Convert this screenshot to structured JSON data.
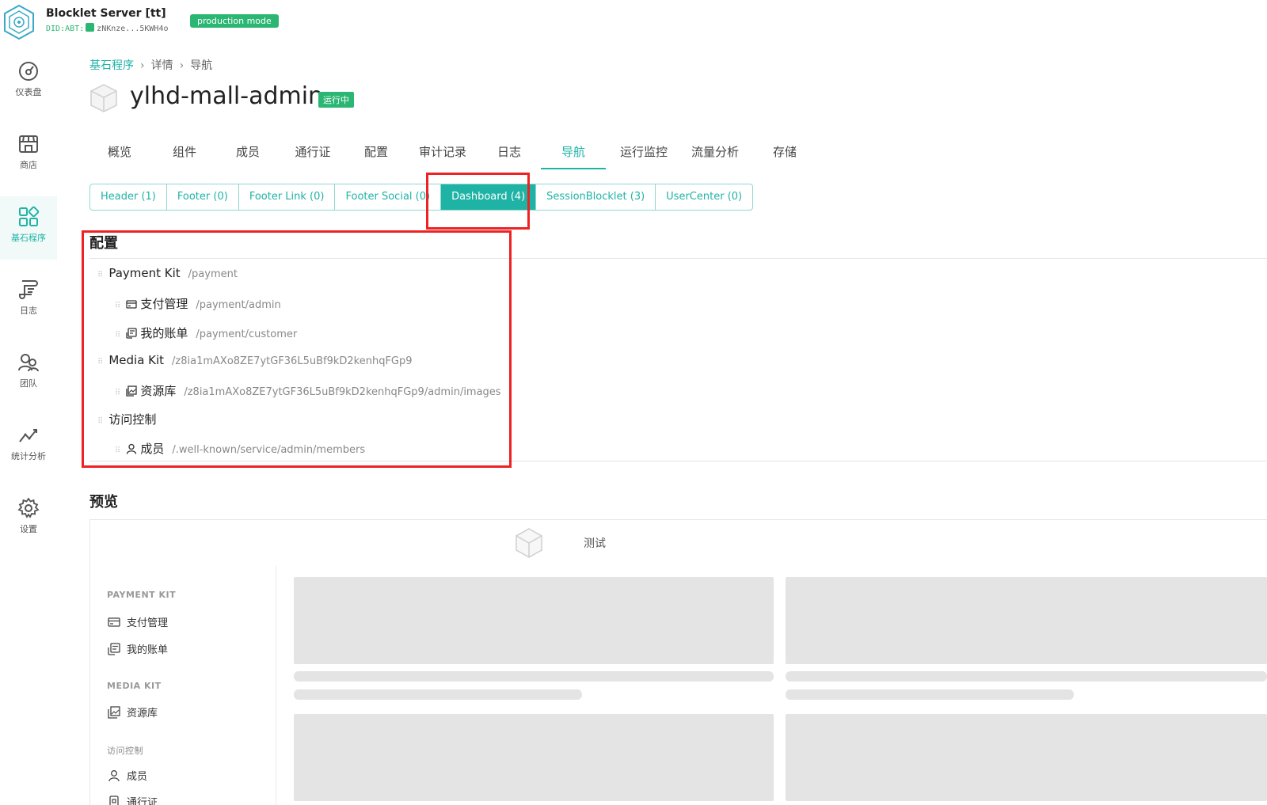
{
  "header": {
    "server_name": "Blocklet Server [tt]",
    "did_prefix": "DID:ABT:",
    "did_value": "zNKnze...5KWH4o",
    "mode_badge": "production mode"
  },
  "sidebar": {
    "items": [
      {
        "label": "仪表盘",
        "icon": "dashboard-icon",
        "active": false
      },
      {
        "label": "商店",
        "icon": "store-icon",
        "active": false
      },
      {
        "label": "基石程序",
        "icon": "blocklets-icon",
        "active": true
      },
      {
        "label": "日志",
        "icon": "log-icon",
        "active": false
      },
      {
        "label": "团队",
        "icon": "team-icon",
        "active": false
      },
      {
        "label": "统计分析",
        "icon": "analytics-icon",
        "active": false
      },
      {
        "label": "设置",
        "icon": "settings-icon",
        "active": false
      }
    ]
  },
  "breadcrumb": {
    "root": "基石程序",
    "middle": "详情",
    "current": "导航"
  },
  "app": {
    "title": "ylhd-mall-admin",
    "status": "运行中"
  },
  "main_tabs": [
    "概览",
    "组件",
    "成员",
    "通行证",
    "配置",
    "审计记录",
    "日志",
    "导航",
    "运行监控",
    "流量分析",
    "存储"
  ],
  "active_main_tab": "导航",
  "sub_tabs": [
    "Header (1)",
    "Footer (0)",
    "Footer Link (0)",
    "Footer Social (0)",
    "Dashboard (4)",
    "SessionBlocklet (3)",
    "UserCenter (0)"
  ],
  "active_sub_tab": "Dashboard (4)",
  "config": {
    "title": "配置",
    "rows": [
      {
        "title": "Payment Kit",
        "path": "/payment",
        "level": 0,
        "icon": ""
      },
      {
        "title": "支付管理",
        "path": "/payment/admin",
        "level": 1,
        "icon": "credit-card-icon"
      },
      {
        "title": "我的账单",
        "path": "/payment/customer",
        "level": 1,
        "icon": "receipt-icon"
      },
      {
        "title": "Media Kit",
        "path": "/z8ia1mAXo8ZE7ytGF36L5uBf9kD2kenhqFGp9",
        "level": 0,
        "icon": ""
      },
      {
        "title": "资源库",
        "path": "/z8ia1mAXo8ZE7ytGF36L5uBf9kD2kenhqFGp9/admin/images",
        "level": 1,
        "icon": "image-library-icon"
      },
      {
        "title": "访问控制",
        "path": "",
        "level": 0,
        "icon": ""
      },
      {
        "title": "成员",
        "path": "/.well-known/service/admin/members",
        "level": 1,
        "icon": "user-icon"
      }
    ]
  },
  "preview": {
    "title": "预览",
    "app_name": "测试",
    "groups": [
      {
        "name": "PAYMENT KIT",
        "items": [
          {
            "label": "支付管理",
            "icon": "credit-card-icon"
          },
          {
            "label": "我的账单",
            "icon": "receipt-icon"
          }
        ]
      },
      {
        "name": "MEDIA KIT",
        "items": [
          {
            "label": "资源库",
            "icon": "image-library-icon"
          }
        ]
      },
      {
        "name": "访问控制",
        "items": [
          {
            "label": "成员",
            "icon": "user-icon"
          },
          {
            "label": "通行证",
            "icon": "pass-icon"
          }
        ]
      }
    ]
  },
  "colors": {
    "accent": "#1fb3a5",
    "success": "#2bb673",
    "highlight": "#ee2222"
  }
}
